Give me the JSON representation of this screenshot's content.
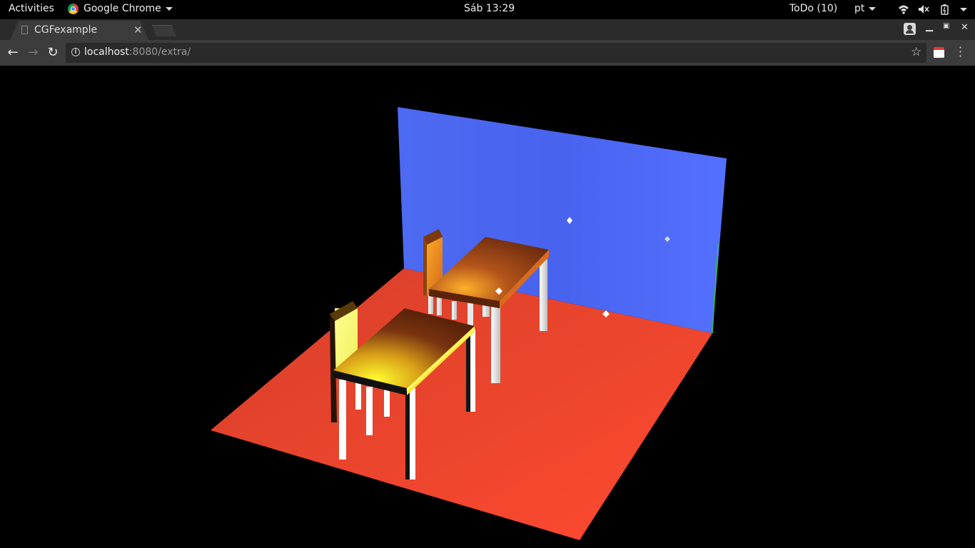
{
  "topbar": {
    "activities": "Activities",
    "app_name": "Google Chrome",
    "clock": "Sáb 13:29",
    "todo": "ToDo (10)",
    "keyboard_layout": "pt"
  },
  "browser": {
    "tab_title": "CGFexample",
    "url_host": "localhost",
    "url_rest": ":8080/extra/"
  },
  "scene": {
    "floor_color": "#e24a30",
    "wall_color": "#4f6cf3",
    "table_top_color": "#b3541a",
    "highlight_color": "#ffff00",
    "leg_color": "#ffffff"
  }
}
